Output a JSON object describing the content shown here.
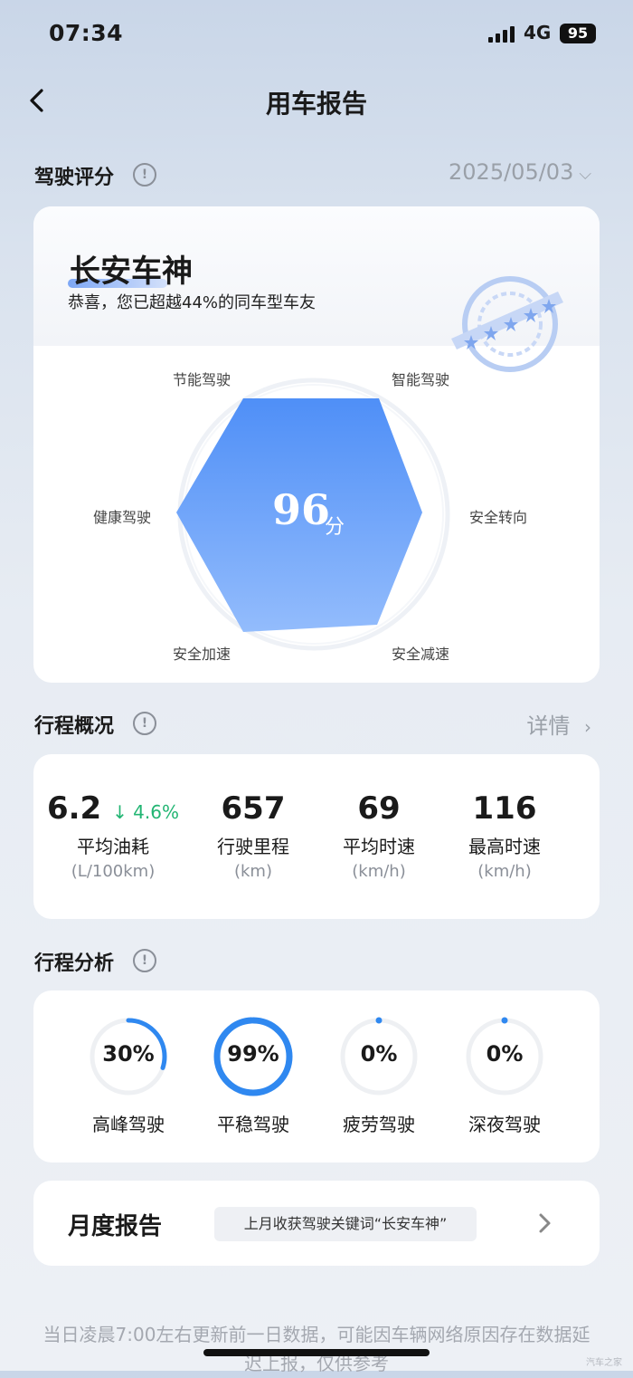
{
  "status": {
    "time": "07:34",
    "network": "4G",
    "battery": "95"
  },
  "nav": {
    "title": "用车报告"
  },
  "driving_score": {
    "section_title": "驾驶评分",
    "date": "2025/05/03",
    "rank_title": "长安车神",
    "rank_sub": "恭喜，您已超越44%的同车型车友",
    "score": "96",
    "score_unit": "分",
    "axes": [
      "节能驾驶",
      "智能驾驶",
      "安全转向",
      "安全减速",
      "安全加速",
      "健康驾驶"
    ]
  },
  "trip_overview": {
    "section_title": "行程概况",
    "detail_label": "详情",
    "stats": [
      {
        "value": "6.2",
        "delta": "↓ 4.6%",
        "name": "平均油耗",
        "unit": "(L/100km)"
      },
      {
        "value": "657",
        "name": "行驶里程",
        "unit": "(km)"
      },
      {
        "value": "69",
        "name": "平均时速",
        "unit": "(km/h)"
      },
      {
        "value": "116",
        "name": "最高时速",
        "unit": "(km/h)"
      }
    ]
  },
  "trip_analysis": {
    "section_title": "行程分析",
    "items": [
      {
        "percent_label": "30%",
        "name": "高峰驾驶",
        "fraction": 0.3
      },
      {
        "percent_label": "99%",
        "name": "平稳驾驶",
        "fraction": 0.99
      },
      {
        "percent_label": "0%",
        "name": "疲劳驾驶",
        "fraction": 0
      },
      {
        "percent_label": "0%",
        "name": "深夜驾驶",
        "fraction": 0
      }
    ]
  },
  "monthly": {
    "title": "月度报告",
    "tag": "上月收获驾驶关键词“长安车神”"
  },
  "footer": "当日凌晨7:00左右更新前一日数据，可能因车辆网络原因存在数据延迟上报，仅供参考",
  "watermark": "汽车之家",
  "colors": {
    "accent": "#2f88f0",
    "down": "#22b573"
  },
  "icons": [
    "back-icon",
    "info-icon",
    "chevron-down-icon",
    "chevron-right-icon",
    "badge-stamp-icon"
  ]
}
